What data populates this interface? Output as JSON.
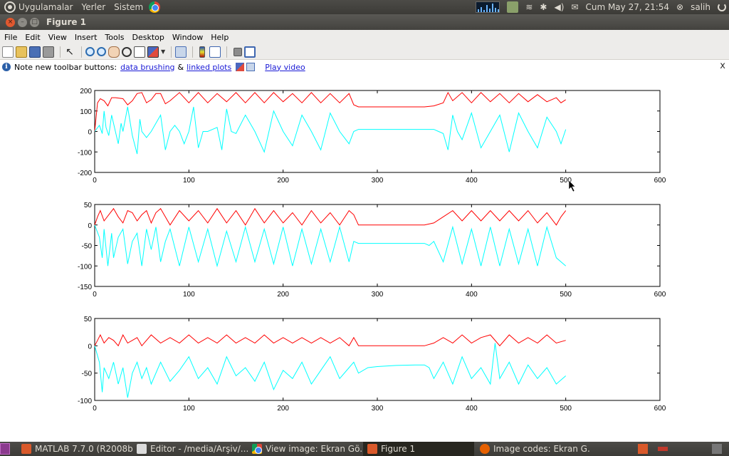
{
  "top_panel": {
    "menus": [
      "Uygulamalar",
      "Yerler",
      "Sistem"
    ],
    "clock": "Cum May 27, 21:54",
    "user": "salih"
  },
  "window": {
    "title": "Figure 1"
  },
  "menubar": [
    "File",
    "Edit",
    "View",
    "Insert",
    "Tools",
    "Desktop",
    "Window",
    "Help"
  ],
  "infobar": {
    "text": "Note new toolbar buttons:",
    "link1": "data brushing",
    "amp": "&",
    "link2": "linked plots",
    "video": "Play video",
    "close": "x"
  },
  "taskbar": {
    "items": [
      {
        "label": "MATLAB  7.7.0 (R2008b)"
      },
      {
        "label": "Editor - /media/Arşiv/..."
      },
      {
        "label": "View image: Ekran Gö..."
      },
      {
        "label": "Figure 1"
      },
      {
        "label": "Image codes: Ekran G..."
      }
    ]
  },
  "colors": {
    "series1": "#ff0000",
    "series2": "#00ffff",
    "axes": "#000000"
  },
  "chart_data": [
    {
      "type": "line",
      "xlim": [
        0,
        600
      ],
      "ylim": [
        -200,
        200
      ],
      "xticks": [
        0,
        100,
        200,
        300,
        400,
        500,
        600
      ],
      "yticks": [
        200,
        100,
        0,
        -100,
        -200
      ],
      "series": [
        {
          "color": "#ff0000",
          "x": [
            0,
            3,
            6,
            10,
            14,
            18,
            22,
            30,
            35,
            40,
            45,
            50,
            55,
            60,
            65,
            70,
            75,
            80,
            90,
            100,
            110,
            120,
            130,
            140,
            150,
            160,
            170,
            180,
            190,
            200,
            210,
            220,
            230,
            240,
            250,
            260,
            270,
            275,
            280,
            290,
            300,
            320,
            340,
            350,
            360,
            370,
            375,
            380,
            390,
            400,
            410,
            420,
            430,
            440,
            450,
            460,
            470,
            480,
            490,
            495,
            500
          ],
          "y": [
            0,
            140,
            160,
            150,
            125,
            165,
            165,
            160,
            130,
            150,
            185,
            190,
            140,
            155,
            185,
            185,
            135,
            150,
            190,
            140,
            190,
            140,
            185,
            145,
            190,
            140,
            190,
            140,
            190,
            145,
            185,
            140,
            190,
            140,
            185,
            140,
            185,
            130,
            120,
            120,
            120,
            120,
            120,
            120,
            125,
            140,
            190,
            150,
            190,
            140,
            190,
            145,
            185,
            140,
            185,
            145,
            180,
            145,
            165,
            140,
            155
          ]
        },
        {
          "color": "#00ffff",
          "x": [
            0,
            5,
            8,
            10,
            12,
            15,
            18,
            22,
            25,
            28,
            30,
            35,
            40,
            45,
            48,
            50,
            55,
            60,
            70,
            75,
            80,
            85,
            90,
            95,
            100,
            105,
            110,
            115,
            120,
            130,
            135,
            140,
            145,
            150,
            160,
            170,
            180,
            190,
            200,
            210,
            220,
            230,
            240,
            250,
            260,
            270,
            275,
            280,
            290,
            300,
            320,
            340,
            350,
            360,
            365,
            370,
            375,
            380,
            385,
            390,
            400,
            410,
            420,
            430,
            440,
            450,
            460,
            470,
            480,
            490,
            495,
            500
          ],
          "y": [
            0,
            30,
            -10,
            100,
            20,
            -20,
            80,
            0,
            -60,
            40,
            0,
            120,
            -20,
            -110,
            60,
            0,
            -30,
            0,
            80,
            -90,
            0,
            30,
            0,
            -60,
            0,
            120,
            -80,
            0,
            0,
            20,
            -90,
            110,
            0,
            -10,
            80,
            0,
            -100,
            100,
            0,
            -70,
            80,
            0,
            -90,
            90,
            0,
            -60,
            0,
            10,
            10,
            10,
            10,
            10,
            10,
            10,
            0,
            -10,
            -90,
            80,
            0,
            -40,
            90,
            -80,
            0,
            80,
            -100,
            90,
            0,
            -80,
            70,
            0,
            -60,
            10
          ]
        }
      ]
    },
    {
      "type": "line",
      "xlim": [
        0,
        600
      ],
      "ylim": [
        -150,
        50
      ],
      "xticks": [
        0,
        100,
        200,
        300,
        400,
        500,
        600
      ],
      "yticks": [
        50,
        0,
        -50,
        -100,
        -150
      ],
      "series": [
        {
          "color": "#ff0000",
          "x": [
            0,
            3,
            6,
            10,
            15,
            20,
            25,
            30,
            35,
            40,
            45,
            50,
            55,
            60,
            65,
            70,
            80,
            90,
            100,
            110,
            120,
            130,
            140,
            150,
            160,
            170,
            180,
            190,
            200,
            210,
            220,
            230,
            240,
            250,
            260,
            270,
            275,
            280,
            300,
            320,
            340,
            350,
            360,
            370,
            380,
            390,
            400,
            410,
            420,
            430,
            440,
            450,
            460,
            470,
            480,
            490,
            495,
            500
          ],
          "y": [
            0,
            20,
            35,
            10,
            25,
            40,
            20,
            5,
            35,
            30,
            10,
            25,
            35,
            5,
            30,
            40,
            0,
            35,
            10,
            35,
            5,
            40,
            5,
            35,
            0,
            40,
            5,
            35,
            5,
            30,
            0,
            35,
            5,
            30,
            0,
            35,
            25,
            0,
            0,
            0,
            0,
            0,
            5,
            20,
            35,
            10,
            35,
            10,
            35,
            10,
            35,
            10,
            35,
            5,
            30,
            0,
            20,
            35
          ]
        },
        {
          "color": "#00ffff",
          "x": [
            0,
            5,
            8,
            10,
            14,
            18,
            20,
            25,
            30,
            35,
            40,
            45,
            50,
            55,
            60,
            65,
            70,
            75,
            80,
            90,
            100,
            110,
            120,
            130,
            140,
            150,
            160,
            170,
            180,
            190,
            200,
            210,
            220,
            230,
            240,
            250,
            260,
            270,
            275,
            280,
            300,
            320,
            340,
            350,
            355,
            360,
            370,
            380,
            390,
            400,
            410,
            420,
            430,
            440,
            450,
            460,
            470,
            480,
            490,
            500
          ],
          "y": [
            0,
            -30,
            -80,
            -10,
            -100,
            -20,
            -80,
            -30,
            -10,
            -95,
            -40,
            -20,
            -100,
            -10,
            -60,
            -5,
            -90,
            -40,
            -10,
            -100,
            -5,
            -90,
            -10,
            -100,
            -15,
            -90,
            -5,
            -90,
            -10,
            -95,
            -5,
            -100,
            -10,
            -95,
            -10,
            -90,
            -5,
            -90,
            -40,
            -45,
            -45,
            -45,
            -45,
            -45,
            -50,
            -40,
            -90,
            -5,
            -95,
            -10,
            -100,
            -5,
            -100,
            -10,
            -95,
            -10,
            -100,
            -5,
            -80,
            -100
          ]
        }
      ]
    },
    {
      "type": "line",
      "xlim": [
        0,
        600
      ],
      "ylim": [
        -100,
        50
      ],
      "xticks": [
        0,
        100,
        200,
        300,
        400,
        500,
        600
      ],
      "yticks": [
        50,
        0,
        -50,
        -100
      ],
      "series": [
        {
          "color": "#ff0000",
          "x": [
            0,
            3,
            6,
            10,
            15,
            20,
            25,
            30,
            35,
            40,
            45,
            50,
            60,
            70,
            80,
            90,
            100,
            110,
            120,
            130,
            140,
            150,
            160,
            170,
            180,
            190,
            200,
            210,
            220,
            230,
            240,
            250,
            260,
            270,
            275,
            280,
            300,
            320,
            340,
            350,
            360,
            370,
            380,
            390,
            400,
            410,
            420,
            430,
            440,
            450,
            460,
            470,
            480,
            490,
            500
          ],
          "y": [
            0,
            10,
            20,
            5,
            15,
            10,
            0,
            20,
            5,
            10,
            15,
            0,
            20,
            5,
            15,
            5,
            20,
            5,
            15,
            5,
            20,
            5,
            15,
            5,
            20,
            5,
            15,
            5,
            15,
            5,
            15,
            5,
            15,
            0,
            15,
            0,
            0,
            0,
            0,
            0,
            5,
            15,
            5,
            20,
            5,
            15,
            20,
            0,
            20,
            5,
            15,
            5,
            20,
            5,
            10
          ]
        },
        {
          "color": "#00ffff",
          "x": [
            0,
            5,
            8,
            10,
            15,
            20,
            25,
            30,
            35,
            40,
            45,
            50,
            55,
            60,
            70,
            80,
            90,
            100,
            110,
            120,
            130,
            140,
            150,
            160,
            170,
            180,
            190,
            200,
            210,
            220,
            230,
            240,
            250,
            260,
            270,
            275,
            280,
            290,
            300,
            320,
            340,
            350,
            355,
            360,
            370,
            380,
            390,
            400,
            410,
            420,
            425,
            430,
            440,
            450,
            460,
            470,
            480,
            490,
            500
          ],
          "y": [
            0,
            -30,
            -85,
            -40,
            -60,
            -30,
            -70,
            -40,
            -95,
            -50,
            -30,
            -60,
            -40,
            -70,
            -30,
            -65,
            -45,
            -20,
            -60,
            -40,
            -70,
            -20,
            -55,
            -40,
            -65,
            -30,
            -80,
            -45,
            -60,
            -30,
            -70,
            -45,
            -20,
            -60,
            -40,
            -30,
            -50,
            -40,
            -38,
            -36,
            -35,
            -35,
            -40,
            -60,
            -30,
            -70,
            -20,
            -60,
            -40,
            -70,
            5,
            -60,
            -30,
            -70,
            -35,
            -60,
            -40,
            -70,
            -55
          ]
        }
      ]
    }
  ]
}
